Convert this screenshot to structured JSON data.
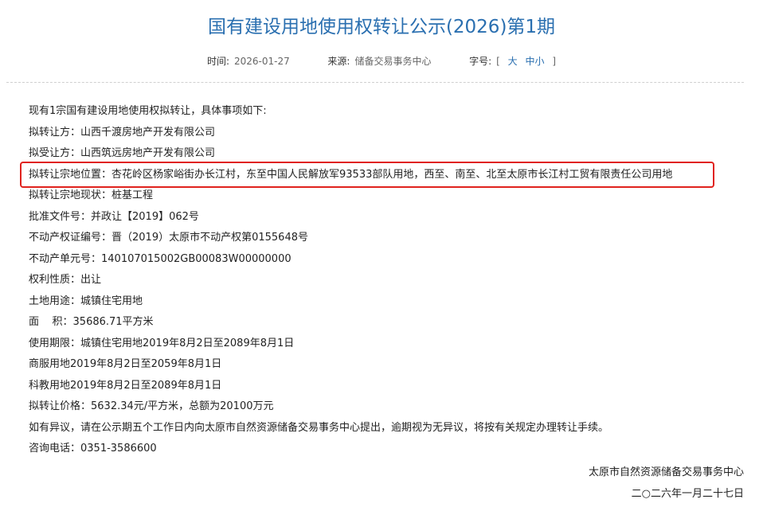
{
  "page": {
    "title": "国有建设用地使用权转让公示(2026)第1期"
  },
  "meta": {
    "time_label": "时间:",
    "time_value": "2026-01-27",
    "source_label": "来源:",
    "source_value": "储备交易事务中心",
    "font_label": "字号:",
    "bracket_open": "[",
    "size_large": "大",
    "size_medium": "中",
    "size_small": "小",
    "bracket_close": "]"
  },
  "content": {
    "intro": "现有1宗国有建设用地使用权拟转让，具体事项如下:",
    "transferor": "拟转让方：山西千渡房地产开发有限公司",
    "transferee": "拟受让方：山西筑远房地产开发有限公司",
    "location": "拟转让宗地位置：杏花岭区杨家峪街办长江村，东至中国人民解放军93533部队用地，西至、南至、北至太原市长江村工贸有限责任公司用地",
    "status": "拟转让宗地现状：桩基工程",
    "approval_doc": "批准文件号：并政让【2019】062号",
    "cert_no": "不动产权证编号：晋（2019）太原市不动产权第0155648号",
    "unit_no": "不动产单元号：140107015002GB00083W00000000",
    "right_type": "权利性质：出让",
    "land_use": "土地用途：城镇住宅用地",
    "area": "面    积：35686.71平方米",
    "term1": "使用期限：城镇住宅用地2019年8月2日至2089年8月1日",
    "term2": "商服用地2019年8月2日至2059年8月1日",
    "term3": "科教用地2019年8月2日至2089年8月1日",
    "price": "拟转让价格：5632.34元/平方米，总额为20100万元",
    "objection": "如有异议，请在公示期五个工作日内向太原市自然资源储备交易事务中心提出，逾期视为无异议，将按有关规定办理转让手续。",
    "phone": "咨询电话：0351-3586600"
  },
  "signature": {
    "org": "太原市自然资源储备交易事务中心",
    "date": "二○二六年一月二十七日"
  },
  "colors": {
    "title": "#2a6fb0",
    "highlight_border": "#e0231e"
  }
}
